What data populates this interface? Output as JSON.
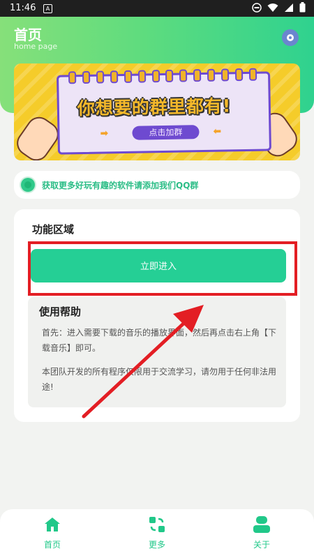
{
  "status_bar": {
    "time": "11:46",
    "indicator": "A"
  },
  "header": {
    "title": "首页",
    "subtitle": "home page",
    "icon": "music-disc-icon"
  },
  "banner": {
    "slogan": "你想要的群里都有!",
    "button": "点击加群"
  },
  "notice": {
    "text": "获取更多好玩有趣的软件请添加我们QQ群"
  },
  "function_area": {
    "title": "功能区域",
    "enter_button": "立即进入",
    "help": {
      "title": "使用帮助",
      "paragraph1": "首先：进入需要下载的音乐的播放界面，然后再点击右上角【下载音乐】即可。",
      "paragraph2": "本团队开发的所有程序仅限用于交流学习，请勿用于任何非法用途!"
    }
  },
  "tabs": [
    {
      "label": "首页",
      "icon": "home-icon"
    },
    {
      "label": "更多",
      "icon": "apps-refresh-icon"
    },
    {
      "label": "关于",
      "icon": "user-icon"
    }
  ],
  "colors": {
    "accent": "#25cf95",
    "highlight": "#e31e24"
  }
}
